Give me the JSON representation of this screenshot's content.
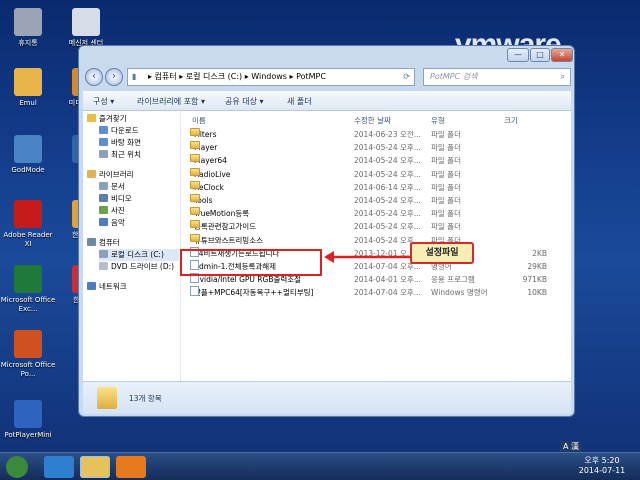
{
  "wallpaper": {
    "brand_text": "vmware"
  },
  "desktop_icons": [
    {
      "label": "휴지통",
      "color": "#9aa4b4"
    },
    {
      "label": "메신저 센터",
      "color": "#d7dde8"
    },
    {
      "label": "Emul",
      "color": "#e8b54a"
    },
    {
      "label": "미디 플레이",
      "color": "#d3892e"
    },
    {
      "label": "GodMode",
      "color": "#4a84c4"
    },
    {
      "label": "반디",
      "color": "#3265a8"
    },
    {
      "label": "Adobe Reader XI",
      "color": "#c61b1b"
    },
    {
      "label": "한글과 사",
      "color": "#e0a23b"
    },
    {
      "label": "Microsoft Office Exc...",
      "color": "#1f7a3a"
    },
    {
      "label": "한글과 2",
      "color": "#c72e3a"
    },
    {
      "label": "Microsoft Office Po...",
      "color": "#d1501f"
    },
    {
      "label": "PotPlayerMini",
      "color": "#2e63c0"
    }
  ],
  "window": {
    "controls": {
      "minimize": "—",
      "maximize": "□",
      "close": "✕"
    },
    "address_path": [
      "컴퓨터",
      "로컬 디스크 (C:)",
      "Windows",
      "PotMPC"
    ],
    "search_placeholder": "PotMPC 검색",
    "toolbar": [
      "구성 ▾",
      "라이브러리에 포함 ▾",
      "공유 대상 ▾",
      "새 폴더"
    ],
    "sidebar": [
      {
        "label": "즐겨찾기",
        "color": "#e8c13b",
        "indent": 0
      },
      {
        "label": "다운로드",
        "color": "#5b8fd0",
        "indent": 1
      },
      {
        "label": "바탕 화면",
        "color": "#5b8fd0",
        "indent": 1
      },
      {
        "label": "최근 위치",
        "color": "#8aa1bd",
        "indent": 1
      },
      {
        "label": "라이브러리",
        "color": "#e2b44f",
        "indent": 0
      },
      {
        "label": "문서",
        "color": "#8aa1bd",
        "indent": 1
      },
      {
        "label": "비디오",
        "color": "#5b7fa8",
        "indent": 1
      },
      {
        "label": "사진",
        "color": "#6da14a",
        "indent": 1
      },
      {
        "label": "음악",
        "color": "#4e7cc0",
        "indent": 1
      },
      {
        "label": "컴퓨터",
        "color": "#6d87a8",
        "indent": 0
      },
      {
        "label": "로컬 디스크 (C:)",
        "color": "#8aa1bd",
        "indent": 1,
        "selected": true
      },
      {
        "label": "DVD 드라이브 (D:)",
        "color": "#b5bfcc",
        "indent": 1
      },
      {
        "label": "네트워크",
        "color": "#4e7cc0",
        "indent": 0
      }
    ],
    "columns": [
      "이름",
      "수정한 날짜",
      "유형",
      "크기"
    ],
    "rows": [
      {
        "name": "Filters",
        "date": "2014-06-23 오전...",
        "type": "파일 폴더",
        "size": "",
        "kind": "folder"
      },
      {
        "name": "Player",
        "date": "2014-05-24 오후...",
        "type": "파일 폴더",
        "size": "",
        "kind": "folder"
      },
      {
        "name": "Player64",
        "date": "2014-05-24 오후...",
        "type": "파일 폴더",
        "size": "",
        "kind": "folder"
      },
      {
        "name": "RadioLive",
        "date": "2014-05-24 오후...",
        "type": "파일 폴더",
        "size": "",
        "kind": "folder"
      },
      {
        "name": "ReClock",
        "date": "2014-06-14 오후...",
        "type": "파일 폴더",
        "size": "",
        "kind": "folder"
      },
      {
        "name": "Tools",
        "date": "2014-05-24 오후...",
        "type": "파일 폴더",
        "size": "",
        "kind": "folder"
      },
      {
        "name": "TrueMotion등록",
        "date": "2014-05-24 오후...",
        "type": "파일 폴더",
        "size": "",
        "kind": "folder"
      },
      {
        "name": "등록관련참고가이드",
        "date": "2014-05-24 오후...",
        "type": "파일 폴더",
        "size": "",
        "kind": "folder"
      },
      {
        "name": "유튜브와스트리밍소스",
        "date": "2014-05-24 오후...",
        "type": "파일 폴더",
        "size": "",
        "kind": "folder"
      },
      {
        "name": "64비트재생기는로드됩니다",
        "date": "2013-12-01 오...",
        "type": "",
        "size": "2KB",
        "kind": "file"
      },
      {
        "name": "Admin-1.전체등록과해제",
        "date": "2014-07-04 오후...",
        "type": "명령어",
        "size": "29KB",
        "kind": "file"
      },
      {
        "name": "Nvidia/Intel GPU RGB출력조절",
        "date": "2014-04-01 오후...",
        "type": "응용 프로그램",
        "size": "971KB",
        "kind": "file"
      },
      {
        "name": "팟플+MPC64[자동복구++멀티부팅]",
        "date": "2014-07-04 오후...",
        "type": "Windows 명령어",
        "size": "10KB",
        "kind": "file"
      }
    ],
    "status_text": "13개 항목",
    "callout_text": "설정파일"
  },
  "taskbar": {
    "tray_lang": "A 漢",
    "time": "오후 5:20",
    "date": "2014-07-11",
    "apps": [
      {
        "name": "start-button",
        "color": "#3b8a3b"
      },
      {
        "name": "ie-icon",
        "color": "#2f7fd0"
      },
      {
        "name": "explorer-icon",
        "color": "#e6c25b"
      },
      {
        "name": "potplayer-icon",
        "color": "#e87a1e"
      }
    ]
  }
}
